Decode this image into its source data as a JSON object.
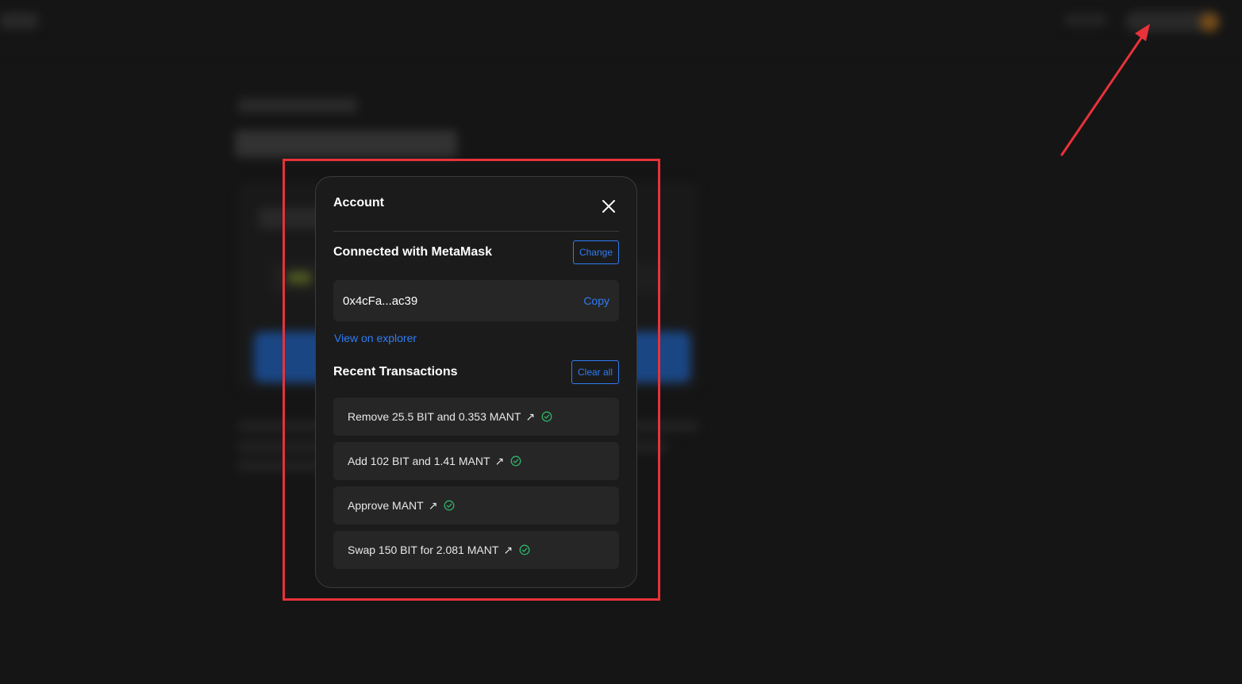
{
  "modal": {
    "title": "Account",
    "connected_label": "Connected with MetaMask",
    "change_label": "Change",
    "address": "0x4cFa...ac39",
    "copy_label": "Copy",
    "explorer_label": "View on explorer",
    "recent_title": "Recent Transactions",
    "clear_label": "Clear all",
    "transactions": [
      {
        "label": "Remove 25.5 BIT and 0.353 MANT",
        "status": "confirmed"
      },
      {
        "label": "Add 102 BIT and 1.41 MANT",
        "status": "confirmed"
      },
      {
        "label": "Approve MANT",
        "status": "confirmed"
      },
      {
        "label": "Swap 150 BIT for 2.081 MANT",
        "status": "confirmed"
      }
    ]
  },
  "colors": {
    "accent_blue": "#2f7cf6",
    "success_green": "#2fb36a",
    "annotation_red": "#e8323a",
    "modal_bg": "#1b1b1b",
    "item_bg": "#262626"
  },
  "icons": {
    "close": "close-icon",
    "external_link": "arrow-up-right-icon",
    "status": "check-circle-icon"
  }
}
